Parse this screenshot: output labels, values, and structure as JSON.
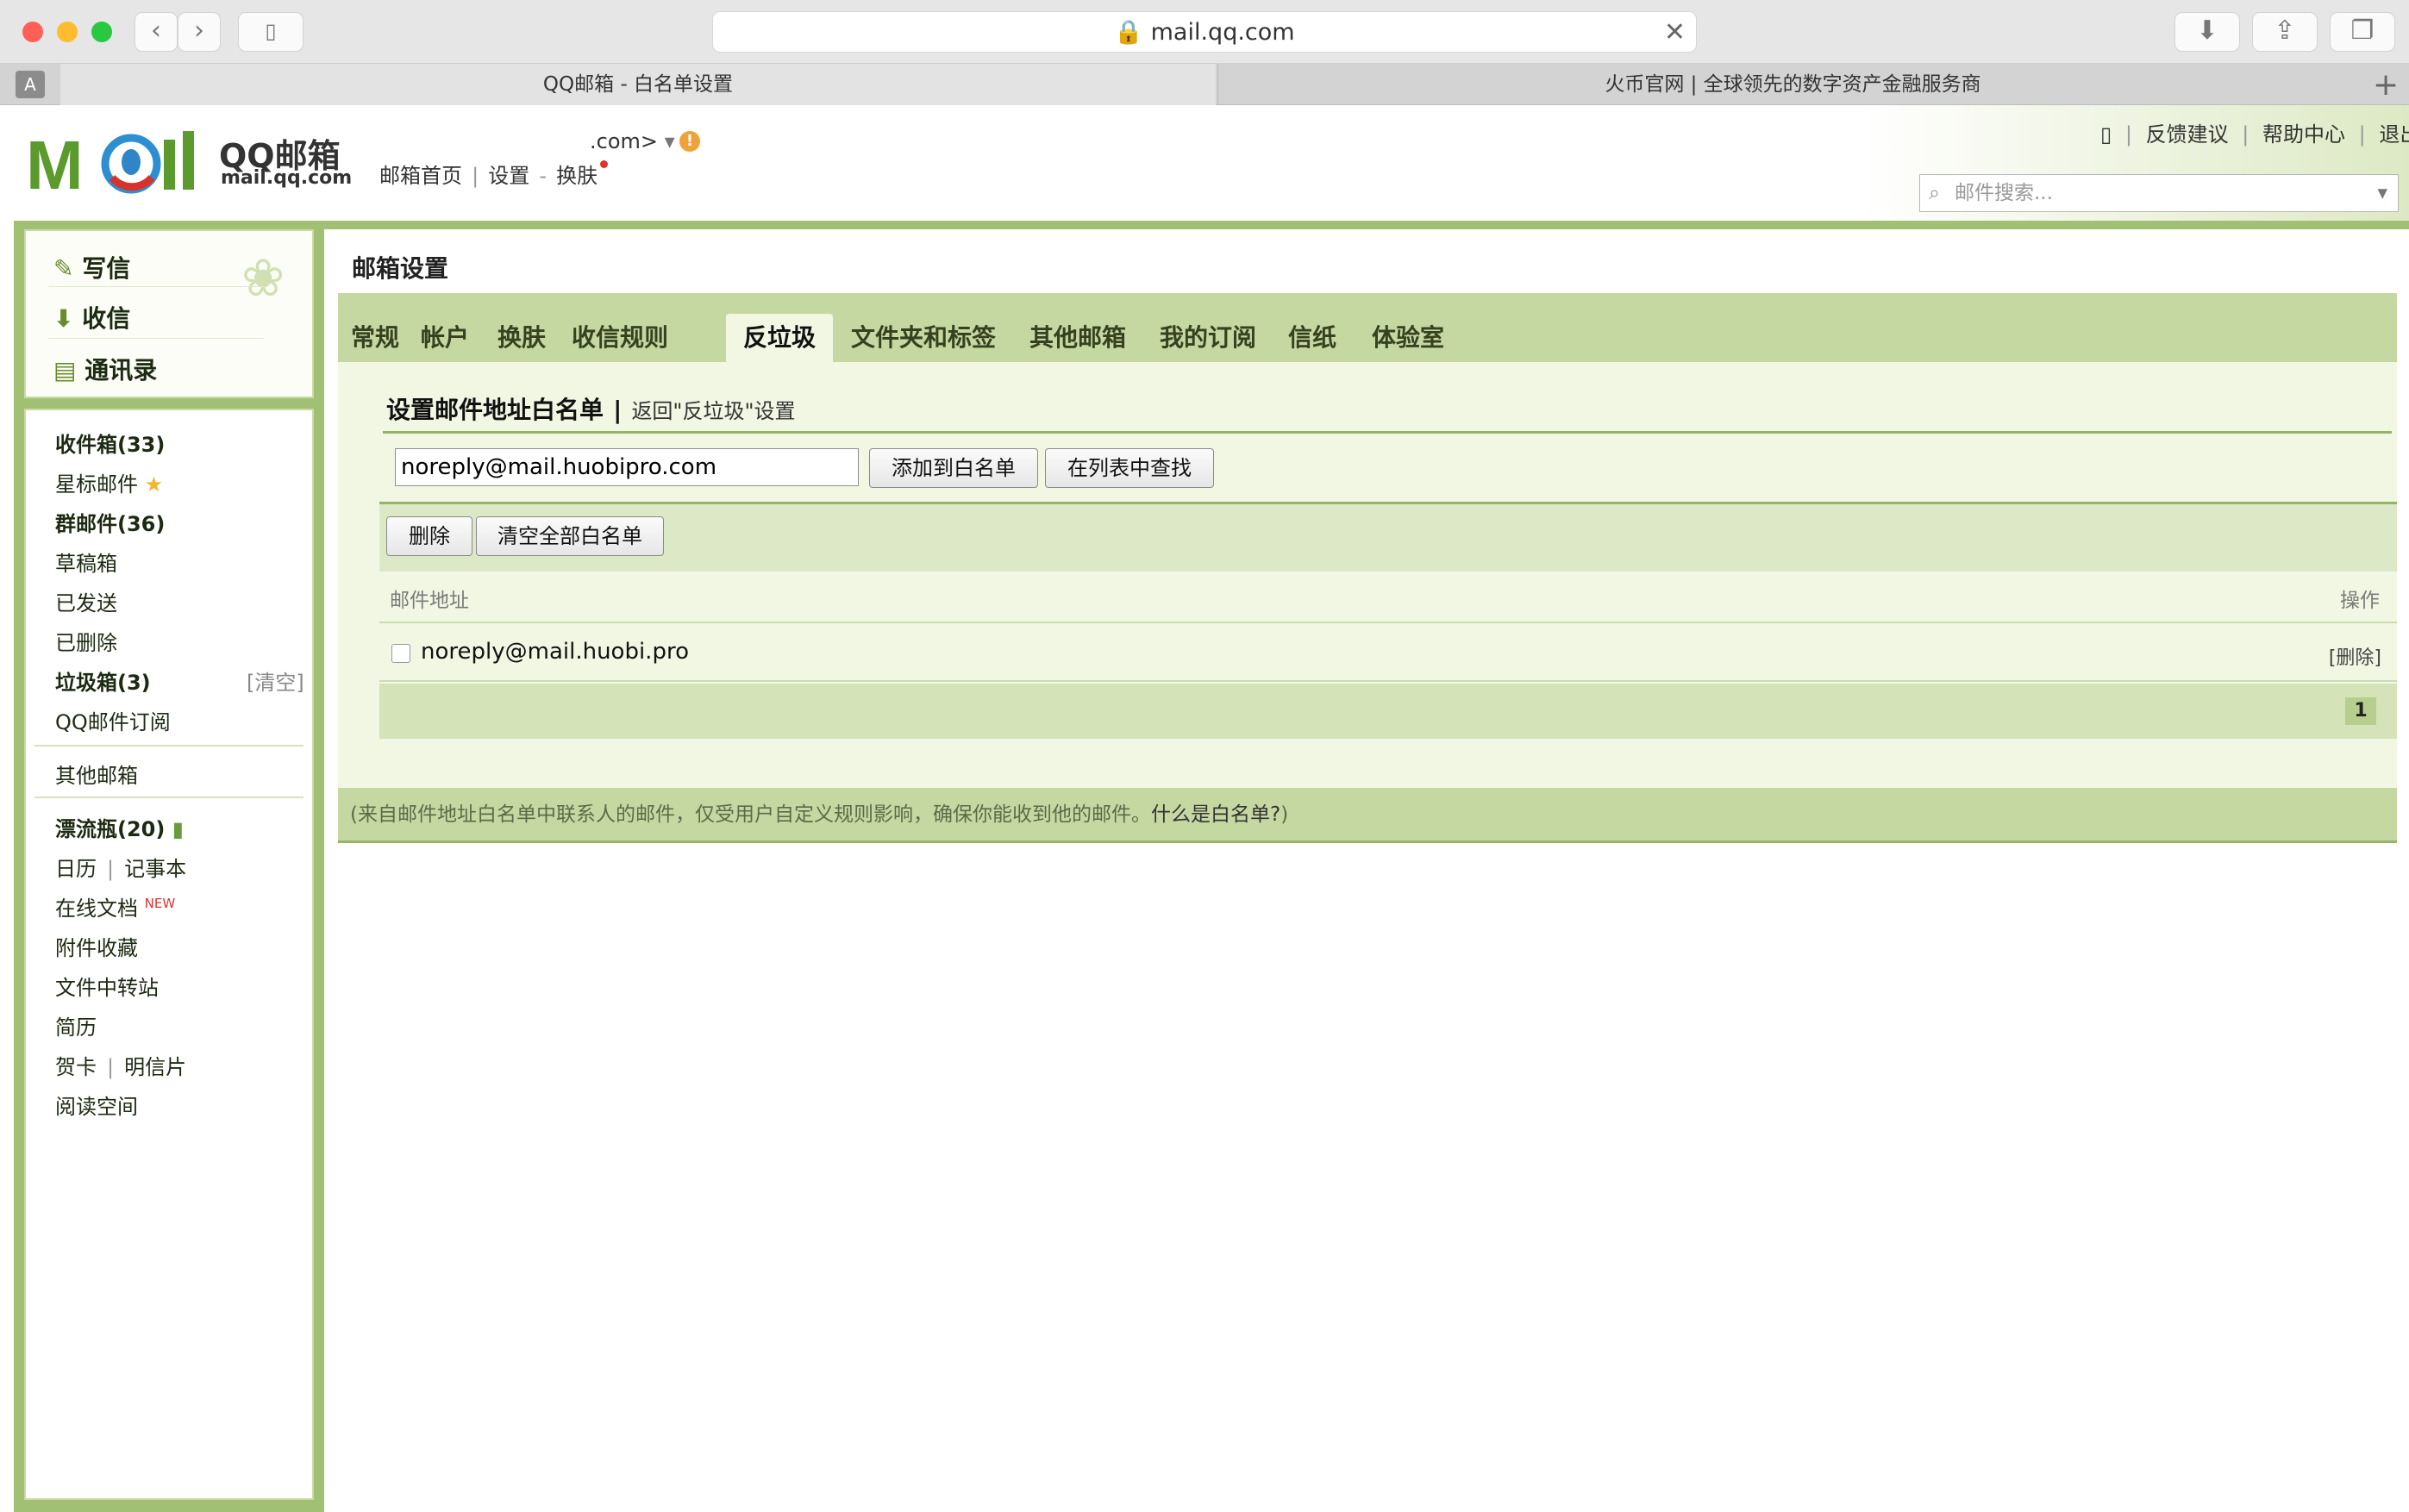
{
  "browser": {
    "address": "mail.qq.com",
    "tabs": [
      "QQ邮箱 - 白名单设置",
      "火币官网 | 全球领先的数字资产金融服务商"
    ]
  },
  "header": {
    "logo_text": "QQ邮箱",
    "logo_domain": "mail.qq.com",
    "account_suffix": ".com>",
    "nav_home": "邮箱首页",
    "nav_settings": "设置",
    "nav_skin": "换肤",
    "sep": "|",
    "dash": "-",
    "top_feedback": "反馈建议",
    "top_help": "帮助中心",
    "top_logout": "退出",
    "search_placeholder": "邮件搜索..."
  },
  "sidebar": {
    "compose": "写信",
    "inbox_btn": "收信",
    "contacts": "通讯录",
    "inbox": "收件箱(33)",
    "starred": "星标邮件",
    "group": "群邮件(36)",
    "drafts": "草稿箱",
    "sent": "已发送",
    "deleted": "已删除",
    "spam": "垃圾箱(3)",
    "spam_clear": "[清空]",
    "subscribe": "QQ邮件订阅",
    "other": "其他邮箱",
    "bottle": "漂流瓶(20)",
    "calendar": "日历",
    "notes": "记事本",
    "docs": "在线文档",
    "docs_badge": "NEW",
    "attachments": "附件收藏",
    "transfer": "文件中转站",
    "resume": "简历",
    "cards": "贺卡",
    "postcards": "明信片",
    "reading": "阅读空间",
    "sep": "|"
  },
  "main": {
    "title": "邮箱设置",
    "tabs": [
      "常规",
      "帐户",
      "换肤",
      "收信规则",
      "反垃圾",
      "文件夹和标签",
      "其他邮箱",
      "我的订阅",
      "信纸",
      "体验室"
    ],
    "active_tab": "反垃圾",
    "section_title": "设置邮件地址白名单",
    "section_sep": "|",
    "back_link": "返回\"反垃圾\"设置",
    "input_value": "noreply@mail.huobipro.com",
    "add_button": "添加到白名单",
    "find_button": "在列表中查找",
    "delete_button": "删除",
    "clear_button": "清空全部白名单",
    "col_address": "邮件地址",
    "col_action": "操作",
    "rows": [
      {
        "address": "noreply@mail.huobi.pro",
        "action": "[删除]"
      }
    ],
    "page": "1",
    "footer_note": "(来自邮件地址白名单中联系人的邮件，仅受用户自定义规则影响，确保你能收到他的邮件。",
    "footer_link": "什么是白名单?",
    "footer_end": ")"
  }
}
